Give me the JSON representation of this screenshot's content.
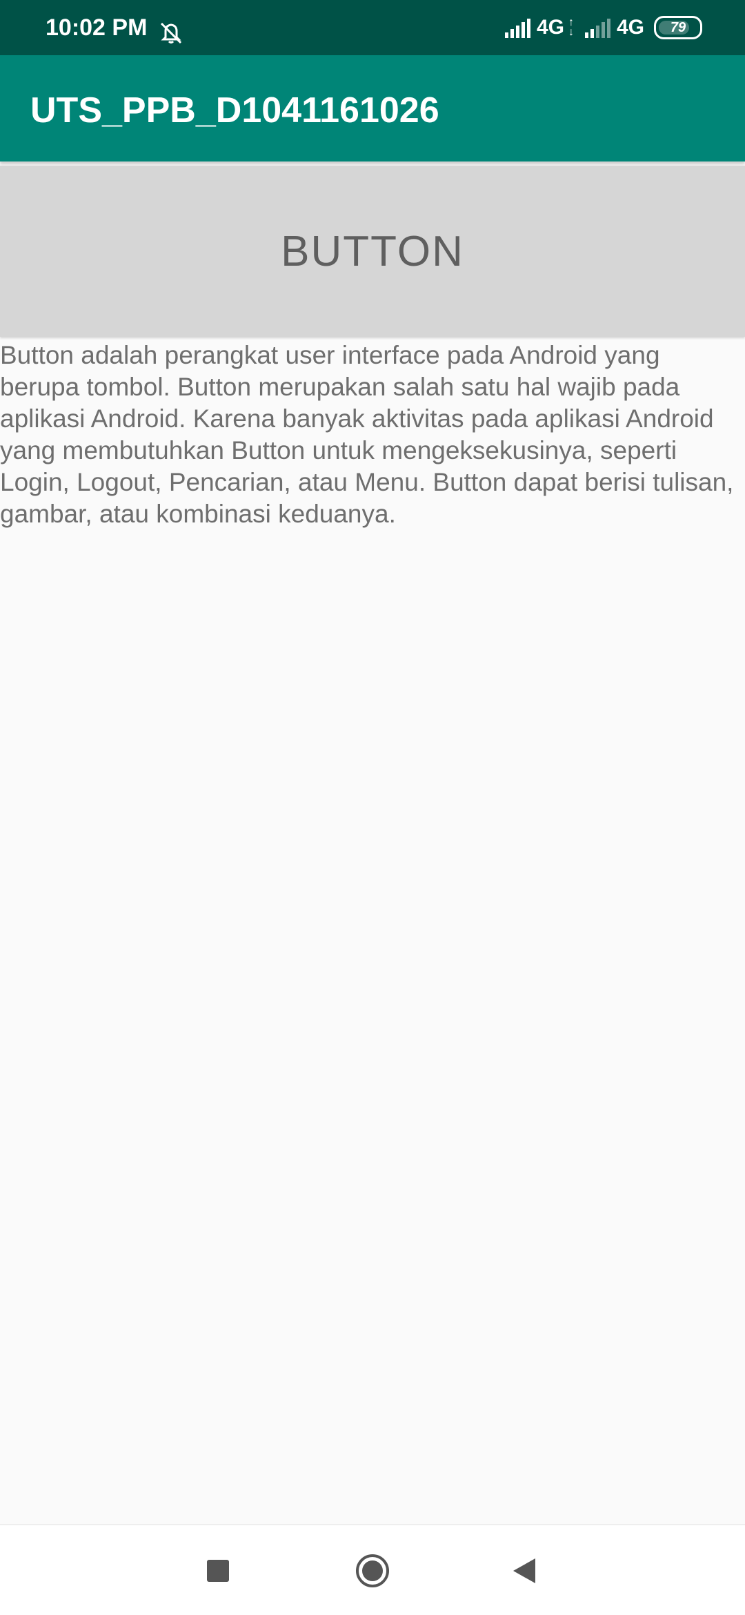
{
  "status_bar": {
    "time": "10:02 PM",
    "mute_icon": "bell-off-icon",
    "network_1": "4G",
    "network_2": "4G",
    "battery_level": "79"
  },
  "app_bar": {
    "title": "UTS_PPB_D1041161026"
  },
  "main": {
    "button_label": "BUTTON",
    "body_lines": [
      "Button adalah perangkat user interface pada Android yang",
      "berupa tombol. Button merupakan salah satu hal wajib pada",
      "aplikasi Android. Karena banyak aktivitas pada aplikasi Android",
      "yang membutuhkan Button untuk mengeksekusinya, seperti",
      "Login, Logout, Pencarian, atau Menu. Button dapat berisi tulisan,",
      "gambar, atau kombinasi keduanya."
    ]
  },
  "nav_bar": {
    "recents_icon": "square-recents-icon",
    "home_icon": "circle-home-icon",
    "back_icon": "triangle-back-icon"
  },
  "colors": {
    "status_bar": "#005247",
    "app_bar": "#008577",
    "button_bg": "#d6d6d6",
    "background": "#fafafa"
  }
}
